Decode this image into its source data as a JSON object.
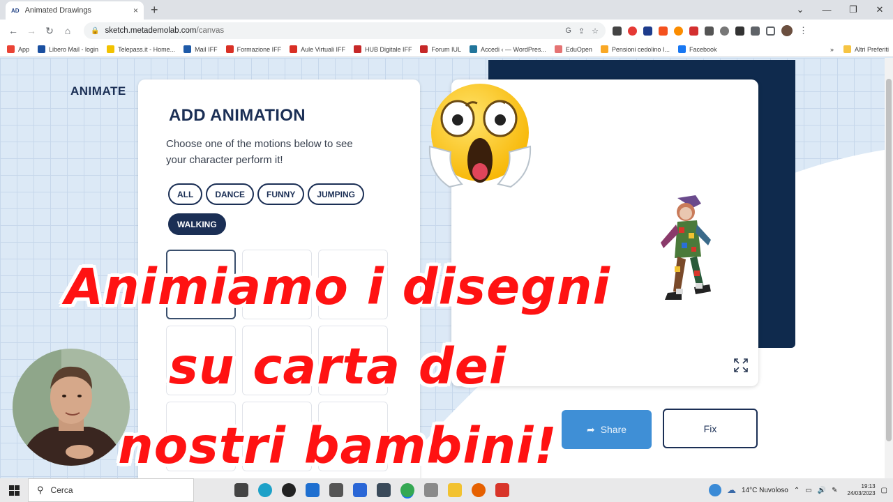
{
  "browser": {
    "tab_icon": "AD",
    "tab_title": "Animated Drawings",
    "tab_close": "×",
    "new_tab": "+",
    "url_host": "sketch.metademolab.com",
    "url_path": "/canvas",
    "window_controls": [
      "⌄",
      "—",
      "❐",
      "✕"
    ]
  },
  "bookmarks": [
    {
      "label": "App",
      "color": "#ea4335"
    },
    {
      "label": "Libero Mail - login",
      "color": "#1a4fa0"
    },
    {
      "label": "Telepass.it - Home...",
      "color": "#f2c200"
    },
    {
      "label": "Mail IFF",
      "color": "#1e5aa8"
    },
    {
      "label": "Formazione IFF",
      "color": "#d93025"
    },
    {
      "label": "Aule Virtuali IFF",
      "color": "#d93025"
    },
    {
      "label": "HUB Digitale IFF",
      "color": "#c62828"
    },
    {
      "label": "Forum IUL",
      "color": "#c62828"
    },
    {
      "label": "Accedi ‹ — WordPres...",
      "color": "#21759b"
    },
    {
      "label": "EduOpen",
      "color": "#e57373"
    },
    {
      "label": "Pensioni cedolino I...",
      "color": "#f9a825"
    },
    {
      "label": "Facebook",
      "color": "#1877f2"
    }
  ],
  "bookmarks_more": "»",
  "bookmarks_other": "Altri Preferiti",
  "app": {
    "logo": "ANIMATE",
    "panel_title": "ADD ANIMATION",
    "panel_desc": "Choose one of the motions below to see your character perform it!",
    "chips": [
      {
        "label": "ALL",
        "active": false
      },
      {
        "label": "DANCE",
        "active": false
      },
      {
        "label": "FUNNY",
        "active": false
      },
      {
        "label": "JUMPING",
        "active": false
      },
      {
        "label": "WALKING",
        "active": true
      }
    ],
    "share_label": "Share",
    "fix_label": "Fix"
  },
  "overlay": {
    "line1": "Animiamo i disegni",
    "line2": "su carta dei",
    "line3": "nostri bambini!",
    "color": "#ff1212"
  },
  "taskbar": {
    "search_label": "Cerca",
    "weather": "14°C  Nuvoloso",
    "time": "19:13",
    "date": "24/03/2023"
  }
}
